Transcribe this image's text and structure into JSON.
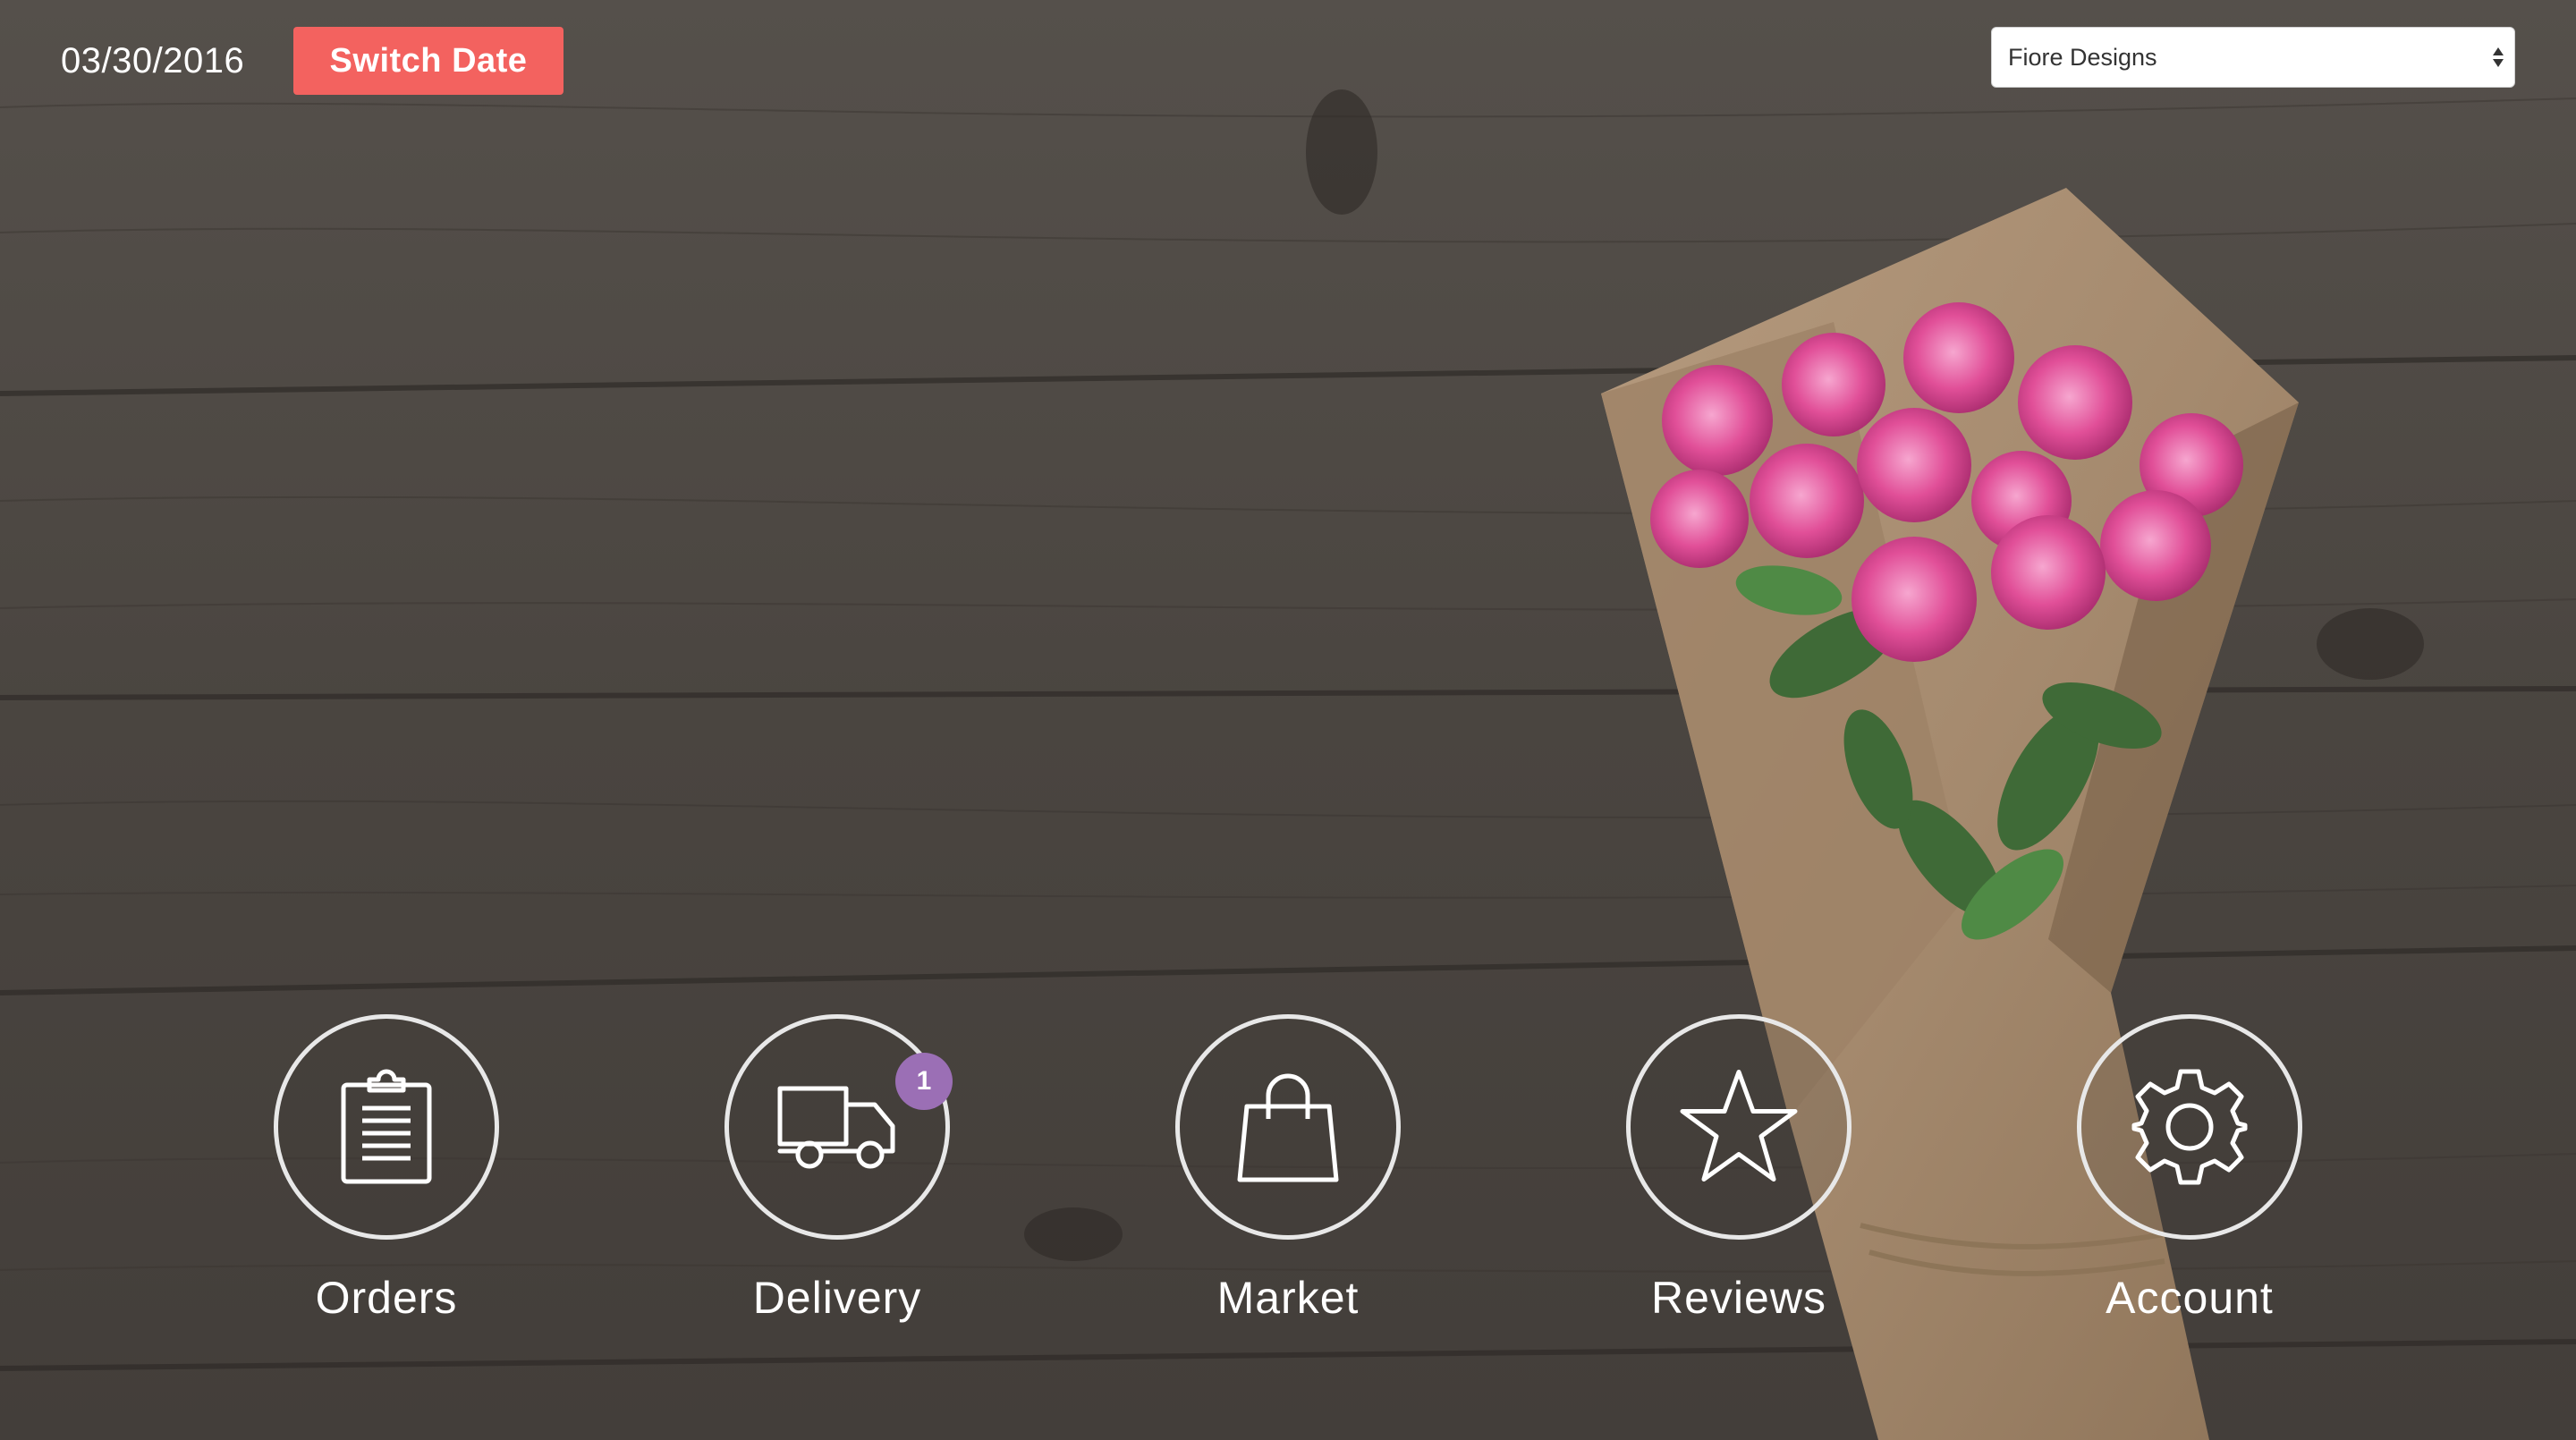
{
  "header": {
    "date": "03/30/2016",
    "switch_date_label": "Switch Date",
    "store_select": {
      "selected": "Fiore Designs"
    }
  },
  "nav": [
    {
      "label": "Orders",
      "icon": "clipboard-icon"
    },
    {
      "label": "Delivery",
      "icon": "delivery-truck-icon",
      "badge": "1"
    },
    {
      "label": "Market",
      "icon": "shopping-bag-icon"
    },
    {
      "label": "Reviews",
      "icon": "star-icon"
    },
    {
      "label": "Account",
      "icon": "gear-icon"
    }
  ],
  "colors": {
    "accent": "#f3625f",
    "badge": "#9b6fb5",
    "icon_stroke": "#ffffff"
  }
}
